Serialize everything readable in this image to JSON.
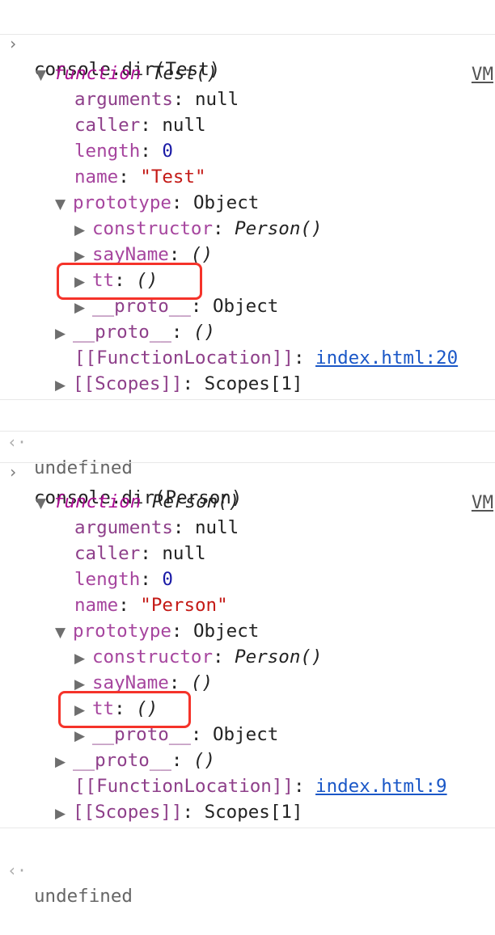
{
  "blocks": [
    {
      "command": "console.dir(Test)",
      "vm_label": "VM",
      "fn_keyword": "function",
      "fn_name": "Test()",
      "arguments": {
        "key": "arguments",
        "value": "null"
      },
      "caller": {
        "key": "caller",
        "value": "null"
      },
      "length": {
        "key": "length",
        "value": "0"
      },
      "name": {
        "key": "name",
        "value": "\"Test\""
      },
      "prototype": {
        "key": "prototype",
        "value": "Object"
      },
      "constructor": {
        "key": "constructor",
        "value": "Person()"
      },
      "sayName": {
        "key": "sayName",
        "value": "()"
      },
      "tt": {
        "key": "tt",
        "value": "()"
      },
      "proto_inner": {
        "key": "__proto__",
        "value": "Object"
      },
      "proto_outer": {
        "key": "__proto__",
        "value": "()"
      },
      "function_location": {
        "key": "[[FunctionLocation]]",
        "value": "index.html:20"
      },
      "scopes": {
        "key": "[[Scopes]]",
        "value": "Scopes[1]"
      },
      "result": "undefined"
    },
    {
      "command": "console.dir(Person)",
      "vm_label": "VM",
      "fn_keyword": "function",
      "fn_name": "Person()",
      "arguments": {
        "key": "arguments",
        "value": "null"
      },
      "caller": {
        "key": "caller",
        "value": "null"
      },
      "length": {
        "key": "length",
        "value": "0"
      },
      "name": {
        "key": "name",
        "value": "\"Person\""
      },
      "prototype": {
        "key": "prototype",
        "value": "Object"
      },
      "constructor": {
        "key": "constructor",
        "value": "Person()"
      },
      "sayName": {
        "key": "sayName",
        "value": "()"
      },
      "tt": {
        "key": "tt",
        "value": "()"
      },
      "proto_inner": {
        "key": "__proto__",
        "value": "Object"
      },
      "proto_outer": {
        "key": "__proto__",
        "value": "()"
      },
      "function_location": {
        "key": "[[FunctionLocation]]",
        "value": "index.html:9"
      },
      "scopes": {
        "key": "[[Scopes]]",
        "value": "Scopes[1]"
      },
      "result": "undefined"
    }
  ],
  "symbols": {
    "prompt": ">",
    "result": "<·",
    "expanded": "▼",
    "collapsed": "▶",
    "colon": ": "
  },
  "colors": {
    "highlight_box": "#f5332a",
    "keyword": "#aa0d91",
    "property": "#a6459e",
    "number": "#1a1aa6",
    "string": "#c41a16",
    "link": "#1a57c7"
  }
}
